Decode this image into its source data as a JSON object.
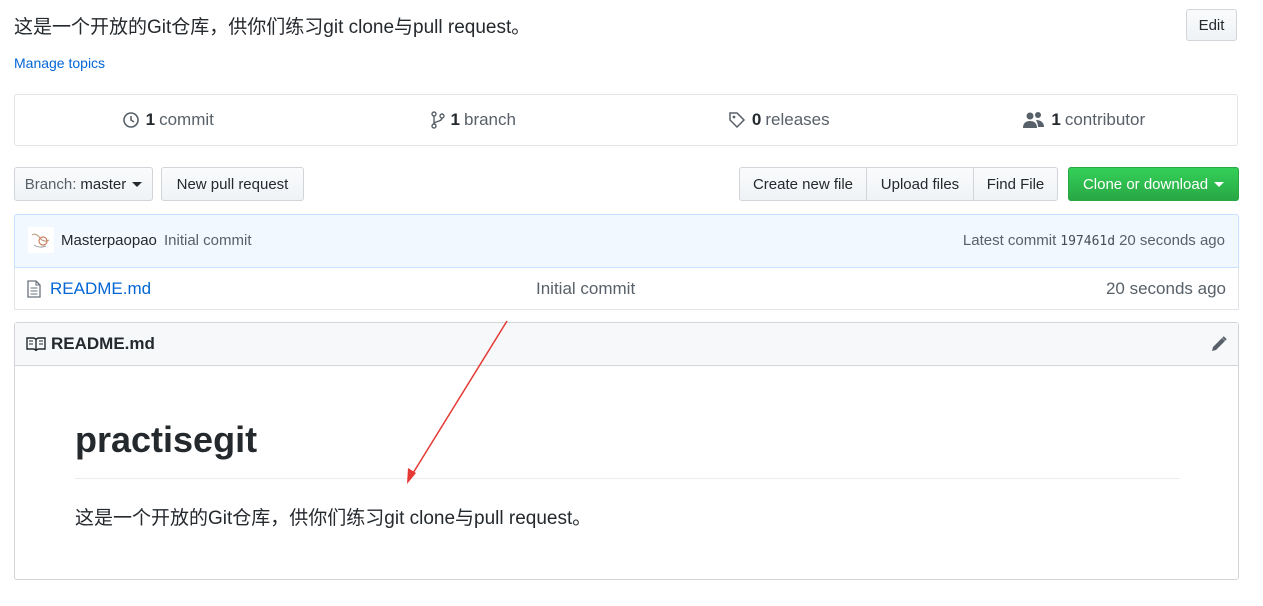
{
  "repo": {
    "description": "这是一个开放的Git仓库，供你们练习git clone与pull request。",
    "edit_label": "Edit",
    "manage_topics_label": "Manage topics"
  },
  "numbers_summary": {
    "commits": {
      "count": "1",
      "label": "commit"
    },
    "branches": {
      "count": "1",
      "label": "branch"
    },
    "releases": {
      "count": "0",
      "label": "releases"
    },
    "contributors": {
      "count": "1",
      "label": "contributor"
    }
  },
  "file_navigation": {
    "branch_prefix": "Branch:",
    "branch_name": "master",
    "new_pull_request": "New pull request",
    "create_new_file": "Create new file",
    "upload_files": "Upload files",
    "find_file": "Find File",
    "clone_or_download": "Clone or download"
  },
  "latest_commit": {
    "author": "Masterpaopao",
    "message": "Initial commit",
    "latest_label": "Latest commit",
    "sha": "197461d",
    "age": "20 seconds ago"
  },
  "files": [
    {
      "name": "README.md",
      "commit_message": "Initial commit",
      "age": "20 seconds ago",
      "icon": "file-text-icon"
    }
  ],
  "readme": {
    "header_title": "README.md",
    "heading": "practisegit",
    "paragraph": "这是一个开放的Git仓库，供你们练习git clone与pull request。"
  },
  "colors": {
    "link": "#0366d6",
    "clone_button": "#28a745",
    "commit_bar": "#f1f8ff",
    "annotation_arrow": "#e53935"
  }
}
